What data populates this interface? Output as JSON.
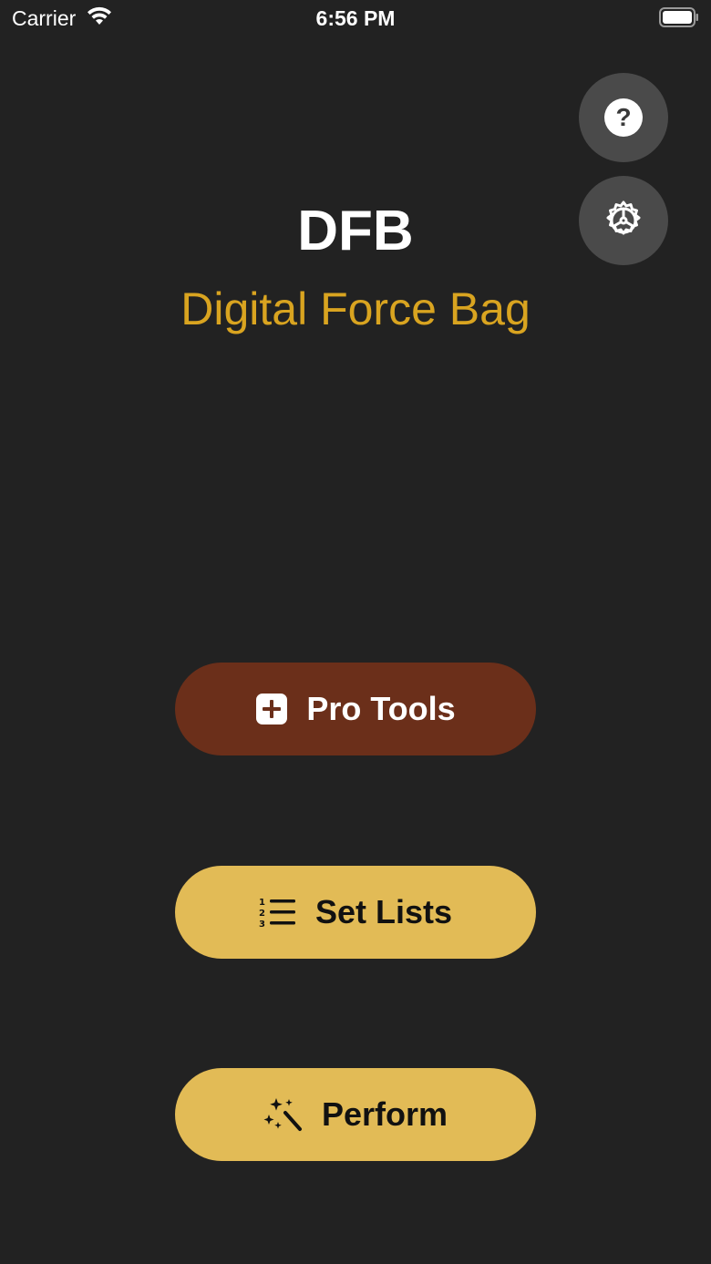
{
  "status_bar": {
    "carrier": "Carrier",
    "time": "6:56 PM",
    "wifi_icon": "wifi-icon",
    "battery_icon": "battery-icon"
  },
  "header": {
    "title": "DFB",
    "subtitle": "Digital Force Bag"
  },
  "top_buttons": {
    "help_icon": "question-mark-icon",
    "help_glyph": "?",
    "settings_icon": "gear-icon"
  },
  "actions": [
    {
      "label": "Pro Tools",
      "icon": "plus-square-icon"
    },
    {
      "label": "Set Lists",
      "icon": "numbered-list-icon"
    },
    {
      "label": "Perform",
      "icon": "magic-wand-icon"
    }
  ],
  "colors": {
    "background": "#222222",
    "accent_gold": "#d9a420",
    "button_gold": "#e2bb56",
    "pro_tools_brown": "#6b2f1a",
    "round_button_gray": "#4a4a4a"
  }
}
